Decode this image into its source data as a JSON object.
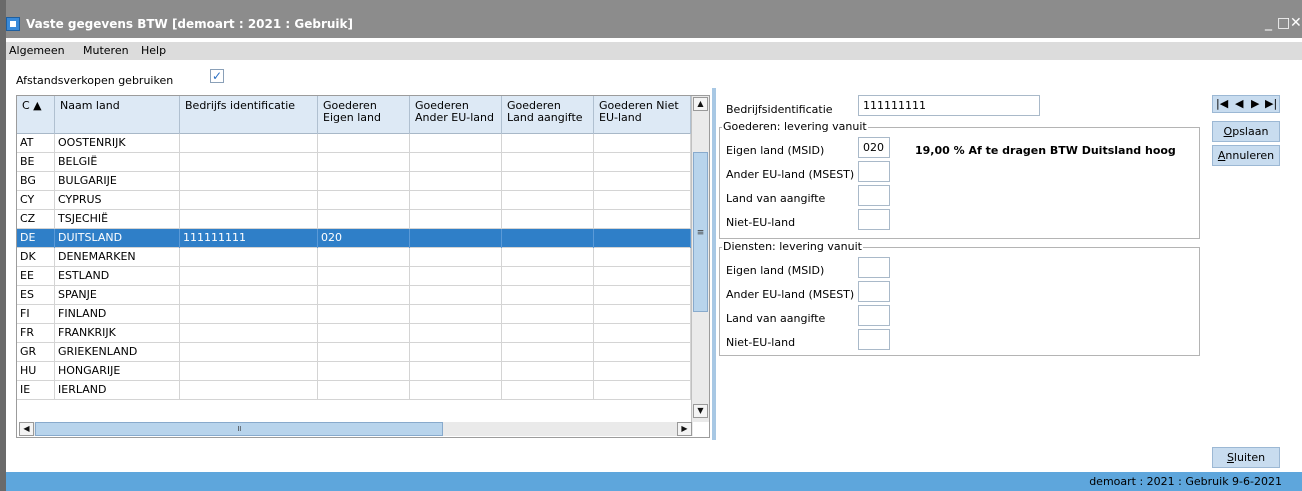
{
  "window": {
    "title": "Vaste gegevens BTW  [demoart : 2021 : Gebruik]",
    "minimize": "_",
    "maximize": "□",
    "close": "✕"
  },
  "menu": [
    "Algemeen",
    "Muteren",
    "Help"
  ],
  "afstandsverkopen": {
    "label": "Afstandsverkopen gebruiken",
    "checked": true,
    "check_glyph": "✓"
  },
  "grid": {
    "columns": [
      {
        "key": "code",
        "label": "C ▲"
      },
      {
        "key": "naam",
        "label": "Naam land"
      },
      {
        "key": "bedrijf",
        "label": "Bedrijfs identificatie"
      },
      {
        "key": "eigen",
        "label": "Goederen Eigen land"
      },
      {
        "key": "ander",
        "label": "Goederen Ander EU-land"
      },
      {
        "key": "aangifte",
        "label": "Goederen Land aangifte"
      },
      {
        "key": "nieteu",
        "label": "Goederen Niet EU-land"
      }
    ],
    "rows": [
      {
        "code": "AT",
        "naam": "OOSTENRIJK",
        "bedrijf": "",
        "eigen": "",
        "ander": "",
        "aangifte": "",
        "nieteu": ""
      },
      {
        "code": "BE",
        "naam": "BELGIË",
        "bedrijf": "",
        "eigen": "",
        "ander": "",
        "aangifte": "",
        "nieteu": ""
      },
      {
        "code": "BG",
        "naam": "BULGARIJE",
        "bedrijf": "",
        "eigen": "",
        "ander": "",
        "aangifte": "",
        "nieteu": ""
      },
      {
        "code": "CY",
        "naam": "CYPRUS",
        "bedrijf": "",
        "eigen": "",
        "ander": "",
        "aangifte": "",
        "nieteu": ""
      },
      {
        "code": "CZ",
        "naam": "TSJECHIË",
        "bedrijf": "",
        "eigen": "",
        "ander": "",
        "aangifte": "",
        "nieteu": ""
      },
      {
        "code": "DE",
        "naam": "DUITSLAND",
        "bedrijf": "111111111",
        "eigen": "020",
        "ander": "",
        "aangifte": "",
        "nieteu": "",
        "selected": true
      },
      {
        "code": "DK",
        "naam": "DENEMARKEN",
        "bedrijf": "",
        "eigen": "",
        "ander": "",
        "aangifte": "",
        "nieteu": ""
      },
      {
        "code": "EE",
        "naam": "ESTLAND",
        "bedrijf": "",
        "eigen": "",
        "ander": "",
        "aangifte": "",
        "nieteu": ""
      },
      {
        "code": "ES",
        "naam": "SPANJE",
        "bedrijf": "",
        "eigen": "",
        "ander": "",
        "aangifte": "",
        "nieteu": ""
      },
      {
        "code": "FI",
        "naam": "FINLAND",
        "bedrijf": "",
        "eigen": "",
        "ander": "",
        "aangifte": "",
        "nieteu": ""
      },
      {
        "code": "FR",
        "naam": "FRANKRIJK",
        "bedrijf": "",
        "eigen": "",
        "ander": "",
        "aangifte": "",
        "nieteu": ""
      },
      {
        "code": "GR",
        "naam": "GRIEKENLAND",
        "bedrijf": "",
        "eigen": "",
        "ander": "",
        "aangifte": "",
        "nieteu": ""
      },
      {
        "code": "HU",
        "naam": "HONGARIJE",
        "bedrijf": "",
        "eigen": "",
        "ander": "",
        "aangifte": "",
        "nieteu": ""
      },
      {
        "code": "IE",
        "naam": "IERLAND",
        "bedrijf": "",
        "eigen": "",
        "ander": "",
        "aangifte": "",
        "nieteu": ""
      }
    ]
  },
  "form": {
    "bedrijf_label": "Bedrijfsidentificatie",
    "bedrijf_value": "111111111",
    "goederen": {
      "title": "Goederen: levering vanuit",
      "eigen_label": "Eigen land (MSID)",
      "eigen_value": "020",
      "eigen_desc": "19,00 %  Af te dragen BTW Duitsland hoog",
      "ander_label": "Ander EU-land (MSEST)",
      "ander_value": "",
      "aangifte_label": "Land van aangifte",
      "aangifte_value": "",
      "nieteu_label": "Niet-EU-land",
      "nieteu_value": ""
    },
    "diensten": {
      "title": "Diensten: levering vanuit",
      "eigen_label": "Eigen land (MSID)",
      "eigen_value": "",
      "ander_label": "Ander EU-land (MSEST)",
      "ander_value": "",
      "aangifte_label": "Land van aangifte",
      "aangifte_value": "",
      "nieteu_label": "Niet-EU-land",
      "nieteu_value": ""
    }
  },
  "buttons": {
    "opslaan_u": "O",
    "opslaan_rest": "pslaan",
    "annuleren_u": "A",
    "annuleren_rest": "nnuleren",
    "sluiten_u": "S",
    "sluiten_rest": "luiten"
  },
  "nav_icons": [
    "first-record-icon",
    "prev-record-icon",
    "next-record-icon",
    "last-record-icon"
  ],
  "status": "demoart : 2021 : Gebruik   9-6-2021",
  "colors": {
    "selected_row": "#2f7fc8",
    "statusbar": "#5ea6dc",
    "header": "#dde9f5",
    "titlebar": "#8c8c8c"
  }
}
